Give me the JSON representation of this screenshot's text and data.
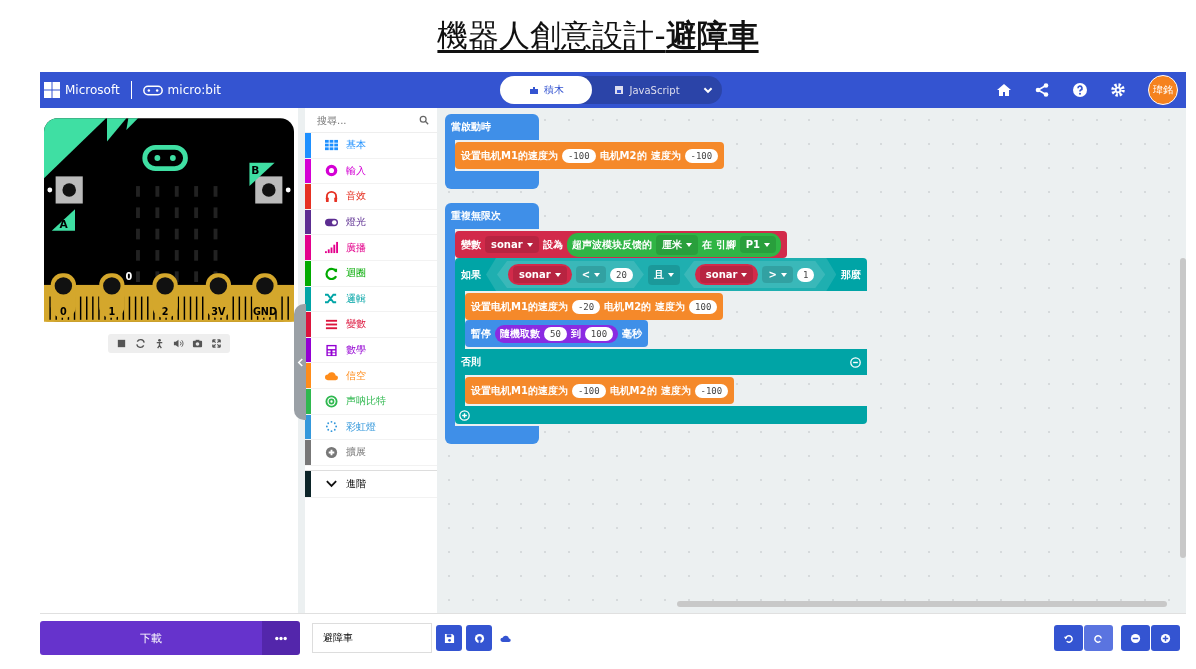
{
  "heading": {
    "text": "機器人創意設計-**避障車**"
  },
  "header": {
    "brand": "Microsoft",
    "product": "micro:bit",
    "tabs": [
      {
        "label": "積木",
        "selected": true,
        "kind": "blocks"
      },
      {
        "label": "JavaScript",
        "selected": false,
        "kind": "js"
      }
    ],
    "avatar": "瑋銘"
  },
  "simulator": {
    "pins": [
      "0",
      "1",
      "2",
      "3V",
      "GND"
    ],
    "pin_reading": "0",
    "button_a": "A",
    "button_b": "B"
  },
  "toolbox": {
    "search_placeholder": "搜尋...",
    "categories": [
      {
        "label": "基本",
        "color": "#1e90ff",
        "kind": "grid"
      },
      {
        "label": "輸入",
        "color": "#d400d4",
        "kind": "circle"
      },
      {
        "label": "音效",
        "color": "#e63022",
        "kind": "headphones"
      },
      {
        "label": "燈光",
        "color": "#5c2d91",
        "kind": "toggle"
      },
      {
        "label": "廣播",
        "color": "#e3008c",
        "kind": "signal"
      },
      {
        "label": "迴圈",
        "color": "#00aa00",
        "kind": "loop"
      },
      {
        "label": "邏輯",
        "color": "#00a4a6",
        "kind": "shuffle"
      },
      {
        "label": "變數",
        "color": "#dc143c",
        "kind": "lines"
      },
      {
        "label": "數學",
        "color": "#9400d3",
        "kind": "calculator"
      },
      {
        "label": "信空",
        "color": "#ff8c1a",
        "kind": "cloud"
      },
      {
        "label": "声呐比特",
        "color": "#2fb84f",
        "kind": "target"
      },
      {
        "label": "彩虹燈",
        "color": "#3498db",
        "kind": "dots"
      },
      {
        "label": "擴展",
        "color": "#777777",
        "kind": "plus"
      }
    ],
    "advanced": "進階"
  },
  "program": [
    {
      "label": "當啟動時",
      "color": "#3f8fe8",
      "body": [
        {
          "kind": "stmt",
          "color": "#f5892a",
          "parts": [
            {
              "kind": "text",
              "text": "设置电机M1的速度为"
            },
            {
              "kind": "num",
              "text": "-100"
            },
            {
              "kind": "text",
              "text": "电机M2的"
            },
            {
              "kind": "text",
              "text": "速度为"
            },
            {
              "kind": "num",
              "text": "-100"
            }
          ]
        }
      ]
    },
    {
      "label": "重複無限次",
      "color": "#3f8fe8",
      "body": [
        {
          "kind": "stmt",
          "color": "#d22a4a",
          "parts": [
            {
              "kind": "text",
              "text": "變數"
            },
            {
              "kind": "drop",
              "text": "sonar"
            },
            {
              "kind": "text",
              "text": "設為"
            },
            {
              "kind": "reporter",
              "color": "#2fb545",
              "parts": [
                {
                  "kind": "text",
                  "text": "超声波模块反馈的"
                },
                {
                  "kind": "drop",
                  "text": "厘米"
                },
                {
                  "kind": "text",
                  "text": "在"
                },
                {
                  "kind": "text",
                  "text": "引腳"
                },
                {
                  "kind": "drop",
                  "text": "P1"
                }
              ]
            }
          ]
        },
        {
          "kind": "if",
          "color": "#00a4a6",
          "label": "如果",
          "then_label": "那麼",
          "else_label": "否則",
          "cond": [
            {
              "kind": "bool",
              "parts": [
                {
                  "kind": "bool",
                  "parts": [
                    {
                      "kind": "reporter",
                      "color": "#d22a4a",
                      "parts": [
                        {
                          "kind": "drop",
                          "text": "sonar"
                        }
                      ]
                    },
                    {
                      "kind": "drop",
                      "text": "<"
                    },
                    {
                      "kind": "num",
                      "text": "20"
                    }
                  ]
                },
                {
                  "kind": "drop",
                  "text": "且"
                },
                {
                  "kind": "bool",
                  "parts": [
                    {
                      "kind": "reporter",
                      "color": "#d22a4a",
                      "parts": [
                        {
                          "kind": "drop",
                          "text": "sonar"
                        }
                      ]
                    },
                    {
                      "kind": "drop",
                      "text": ">"
                    },
                    {
                      "kind": "num",
                      "text": "1"
                    }
                  ]
                }
              ]
            }
          ],
          "body": [
            {
              "kind": "stmt",
              "color": "#f5892a",
              "parts": [
                {
                  "kind": "text",
                  "text": "设置电机M1的速度为"
                },
                {
                  "kind": "num",
                  "text": "-20"
                },
                {
                  "kind": "text",
                  "text": "电机M2的"
                },
                {
                  "kind": "text",
                  "text": "速度为"
                },
                {
                  "kind": "num",
                  "text": "100"
                }
              ]
            },
            {
              "kind": "stmt",
              "color": "#3f8fe8",
              "parts": [
                {
                  "kind": "text",
                  "text": "暫停"
                },
                {
                  "kind": "reporter",
                  "color": "#8a2be2",
                  "parts": [
                    {
                      "kind": "text",
                      "text": "隨機取數"
                    },
                    {
                      "kind": "num",
                      "text": "50"
                    },
                    {
                      "kind": "text",
                      "text": "到"
                    },
                    {
                      "kind": "num",
                      "text": "100"
                    }
                  ]
                },
                {
                  "kind": "text",
                  "text": "毫秒"
                }
              ]
            }
          ],
          "else_body": [
            {
              "kind": "stmt",
              "color": "#f5892a",
              "parts": [
                {
                  "kind": "text",
                  "text": "设置电机M1的速度为"
                },
                {
                  "kind": "num",
                  "text": "-100"
                },
                {
                  "kind": "text",
                  "text": "电机M2的"
                },
                {
                  "kind": "text",
                  "text": "速度为"
                },
                {
                  "kind": "num",
                  "text": "-100"
                }
              ]
            }
          ]
        }
      ]
    }
  ],
  "bottom": {
    "download": "下載",
    "project_name": "避障車"
  }
}
